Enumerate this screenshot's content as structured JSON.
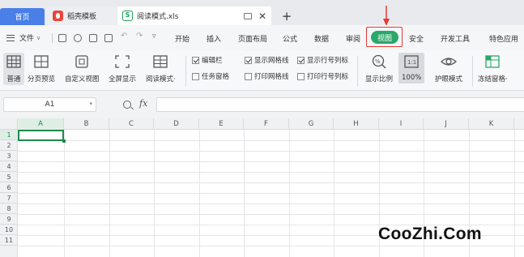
{
  "tabs": {
    "home": "首页",
    "template": "稻壳模板",
    "file": "阅读模式.xls",
    "file_badge": "S",
    "plus": "+"
  },
  "menu": {
    "file": "文件",
    "items": [
      "开始",
      "插入",
      "页面布局",
      "公式",
      "数据",
      "审阅",
      "视图",
      "安全",
      "开发工具",
      "特色应用"
    ],
    "active_index": 6
  },
  "ribbon": {
    "normal": "普通",
    "page_break": "分页预览",
    "custom_view": "自定义视图",
    "fullscreen": "全屏显示",
    "reading_mode": "阅读模式·",
    "edit_bar": "编辑栏",
    "task_pane": "任务窗格",
    "show_gridlines": "显示网格线",
    "print_gridlines": "打印网格线",
    "show_headings": "显示行号列标",
    "print_headings": "打印行号列标",
    "zoom": "显示比例",
    "zoom_100": "100%",
    "eye_mode": "护眼模式",
    "freeze": "冻结窗格·"
  },
  "formula_bar": {
    "cell_ref": "A1",
    "fx": "fx",
    "value": ""
  },
  "sheet": {
    "columns": [
      "A",
      "B",
      "C",
      "D",
      "E",
      "F",
      "G",
      "H",
      "I",
      "J",
      "K"
    ],
    "rows": [
      "1",
      "2",
      "3",
      "4",
      "5",
      "6",
      "7",
      "8",
      "9",
      "10",
      "11"
    ]
  },
  "watermark": "CooZhi.Com",
  "colors": {
    "accent_green": "#2aa86a",
    "home_tab_blue": "#4a7fe8",
    "highlight_red": "#e53a32"
  }
}
